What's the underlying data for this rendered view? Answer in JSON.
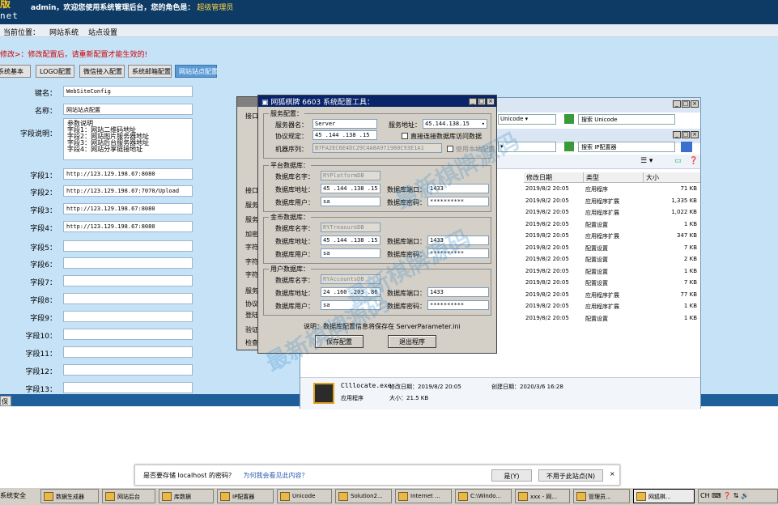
{
  "topbar": {
    "brand": "版",
    "brand2": "net",
    "message": "admin，欢迎您使用系统管理后台，您的角色是：",
    "role": "超级管理员"
  },
  "breadcrumb": {
    "label": "当前位置：",
    "item1": "网站系统",
    "item2": "站点设置"
  },
  "warning": "修改>：修改配置后，请重新配置才能生效的!",
  "tabs": [
    "系统基本",
    "LOGO配置",
    "微信接入配置",
    "系统邮箱配置",
    "网站站点配置"
  ],
  "form": {
    "rows": [
      {
        "label": "键名：",
        "value": "WebSiteConfig"
      },
      {
        "label": "名称：",
        "value": "网站站点配置"
      },
      {
        "label": "字段1：",
        "value": "http://123.129.198.67:8080"
      },
      {
        "label": "字段2：",
        "value": "http://123.129.198.67:7070/Upload"
      },
      {
        "label": "字段3：",
        "value": "http://123.129.198.67:8080"
      },
      {
        "label": "字段4：",
        "value": "http://123.129.198.67:8080"
      },
      {
        "label": "字段5：",
        "value": ""
      },
      {
        "label": "字段6：",
        "value": ""
      },
      {
        "label": "字段7：",
        "value": ""
      },
      {
        "label": "字段8：",
        "value": ""
      },
      {
        "label": "字段9：",
        "value": ""
      },
      {
        "label": "字段10：",
        "value": ""
      },
      {
        "label": "字段11：",
        "value": ""
      },
      {
        "label": "字段12：",
        "value": ""
      },
      {
        "label": "字段13：",
        "value": ""
      }
    ],
    "desc_label": "字段说明：",
    "desc_lines": [
      "参数说明",
      "字段1：网站二维码地址",
      "字段2：网站图片服务器地址",
      "字段3：网站后台服务器地址",
      "字段4：网站分享链接地址"
    ]
  },
  "bottom_button": "保",
  "config_window": {
    "title": "网狐棋牌 6603 系统配置工具：",
    "g1": {
      "title": "服务配置：",
      "server_name_label": "服务器名：",
      "server_name": "Server",
      "protocol_label": "协议规定：",
      "protocol": "45 .144 .138 .15",
      "addr_label": "服务地址：",
      "addr": "45.144.138.15",
      "check1": "直接连接数据库访问数据",
      "machine_label": "机器序列：",
      "machine": "B7FA2EC6E4DC29C4A8A971980C93E1A1",
      "check2": "使用本地配置"
    },
    "g2": {
      "title": "平台数据库：",
      "name_label": "数据库名字：",
      "name": "RYPlatformDB",
      "addr_label": "数据库地址：",
      "addr": "45 .144 .138 .15",
      "port_label": "数据库端口：",
      "port": "1433",
      "user_label": "数据库用户：",
      "user": "sa",
      "pwd_label": "数据库密码：",
      "pwd": "**********"
    },
    "g3": {
      "title": "金币数据库：",
      "name_label": "数据库名字：",
      "name": "RYTreasureDB",
      "addr_label": "数据库地址：",
      "addr": "45 .144 .138 .15",
      "port_label": "数据库端口：",
      "port": "1433",
      "user_label": "数据库用户：",
      "user": "sa",
      "pwd_label": "数据库密码：",
      "pwd": "**********"
    },
    "g4": {
      "title": "用户数据库：",
      "name_label": "数据库名字：",
      "name": "RYAccountsDB",
      "addr_label": "数据库地址：",
      "addr": "24 .160 .203 .86",
      "port_label": "数据库端口：",
      "port": "1433",
      "user_label": "数据库用户：",
      "user": "sa",
      "pwd_label": "数据库密码：",
      "pwd": "**********"
    },
    "note": "说明：数据库配置信息将保存在 ServerParameter.ini",
    "save_btn": "保存配置",
    "cancel_btn": "退出程序"
  },
  "back_window": {
    "title": "",
    "labels": [
      "接口",
      "接口",
      "服务",
      "服务",
      "加密",
      "字符",
      "字符",
      "字符",
      "服务",
      "协议",
      "登陆",
      "验证",
      "检查"
    ]
  },
  "explorer": {
    "addr1": "Unicode",
    "search1": "搜索 Unicode",
    "addr2": "",
    "search2": "搜索 IP配置器",
    "headers": [
      "修改日期",
      "类型",
      "大小"
    ],
    "rows": [
      {
        "date": "2019/8/2 20:05",
        "type": "应用程序",
        "size": "71 KB"
      },
      {
        "date": "2019/8/2 20:05",
        "type": "应用程序扩展",
        "size": "1,335 KB"
      },
      {
        "date": "2019/8/2 20:05",
        "type": "应用程序扩展",
        "size": "1,022 KB"
      },
      {
        "date": "2019/8/2 20:05",
        "type": "配置设置",
        "size": "1 KB"
      },
      {
        "date": "2019/8/2 20:05",
        "type": "应用程序扩展",
        "size": "347 KB"
      },
      {
        "date": "2019/8/2 20:05",
        "type": "配置设置",
        "size": "7 KB"
      },
      {
        "date": "2019/8/2 20:05",
        "type": "配置设置",
        "size": "2 KB"
      },
      {
        "date": "2019/8/2 20:05",
        "type": "配置设置",
        "size": "1 KB"
      },
      {
        "date": "2019/8/2 20:05",
        "type": "配置设置",
        "size": "7 KB"
      },
      {
        "date": "2019/8/2 20:05",
        "type": "应用程序扩展",
        "size": "77 KB"
      },
      {
        "date": "2019/8/2 20:05",
        "type": "应用程序扩展",
        "size": "1 KB"
      },
      {
        "date": "2019/8/2 20:05",
        "type": "配置设置",
        "size": "1 KB"
      }
    ],
    "details": {
      "name": "Clllocate.exe",
      "mod_label": "修改日期：",
      "mod": "2019/8/2 20:05",
      "create_label": "创建日期：",
      "create": "2020/3/6 16:28",
      "type": "应用程序",
      "size_label": "大小：",
      "size": "21.5 KB"
    }
  },
  "notification": {
    "text": "是否要存储 localhost 的密码？",
    "link": "为何我会看见此内容？",
    "yes": "是(Y)",
    "no": "不用于此站点(N)",
    "close": "×"
  },
  "taskbar": {
    "start": "系统安全",
    "items": [
      "数据生成器",
      "网站后台",
      "库数据",
      "IP配置器",
      "Unicode",
      "Solution2...",
      "Internet ...",
      "C:\\Windo...",
      "xxx - 网...",
      "管理员...",
      "网狐棋..."
    ],
    "tray": "CH"
  },
  "watermark": "最新棋牌源码"
}
